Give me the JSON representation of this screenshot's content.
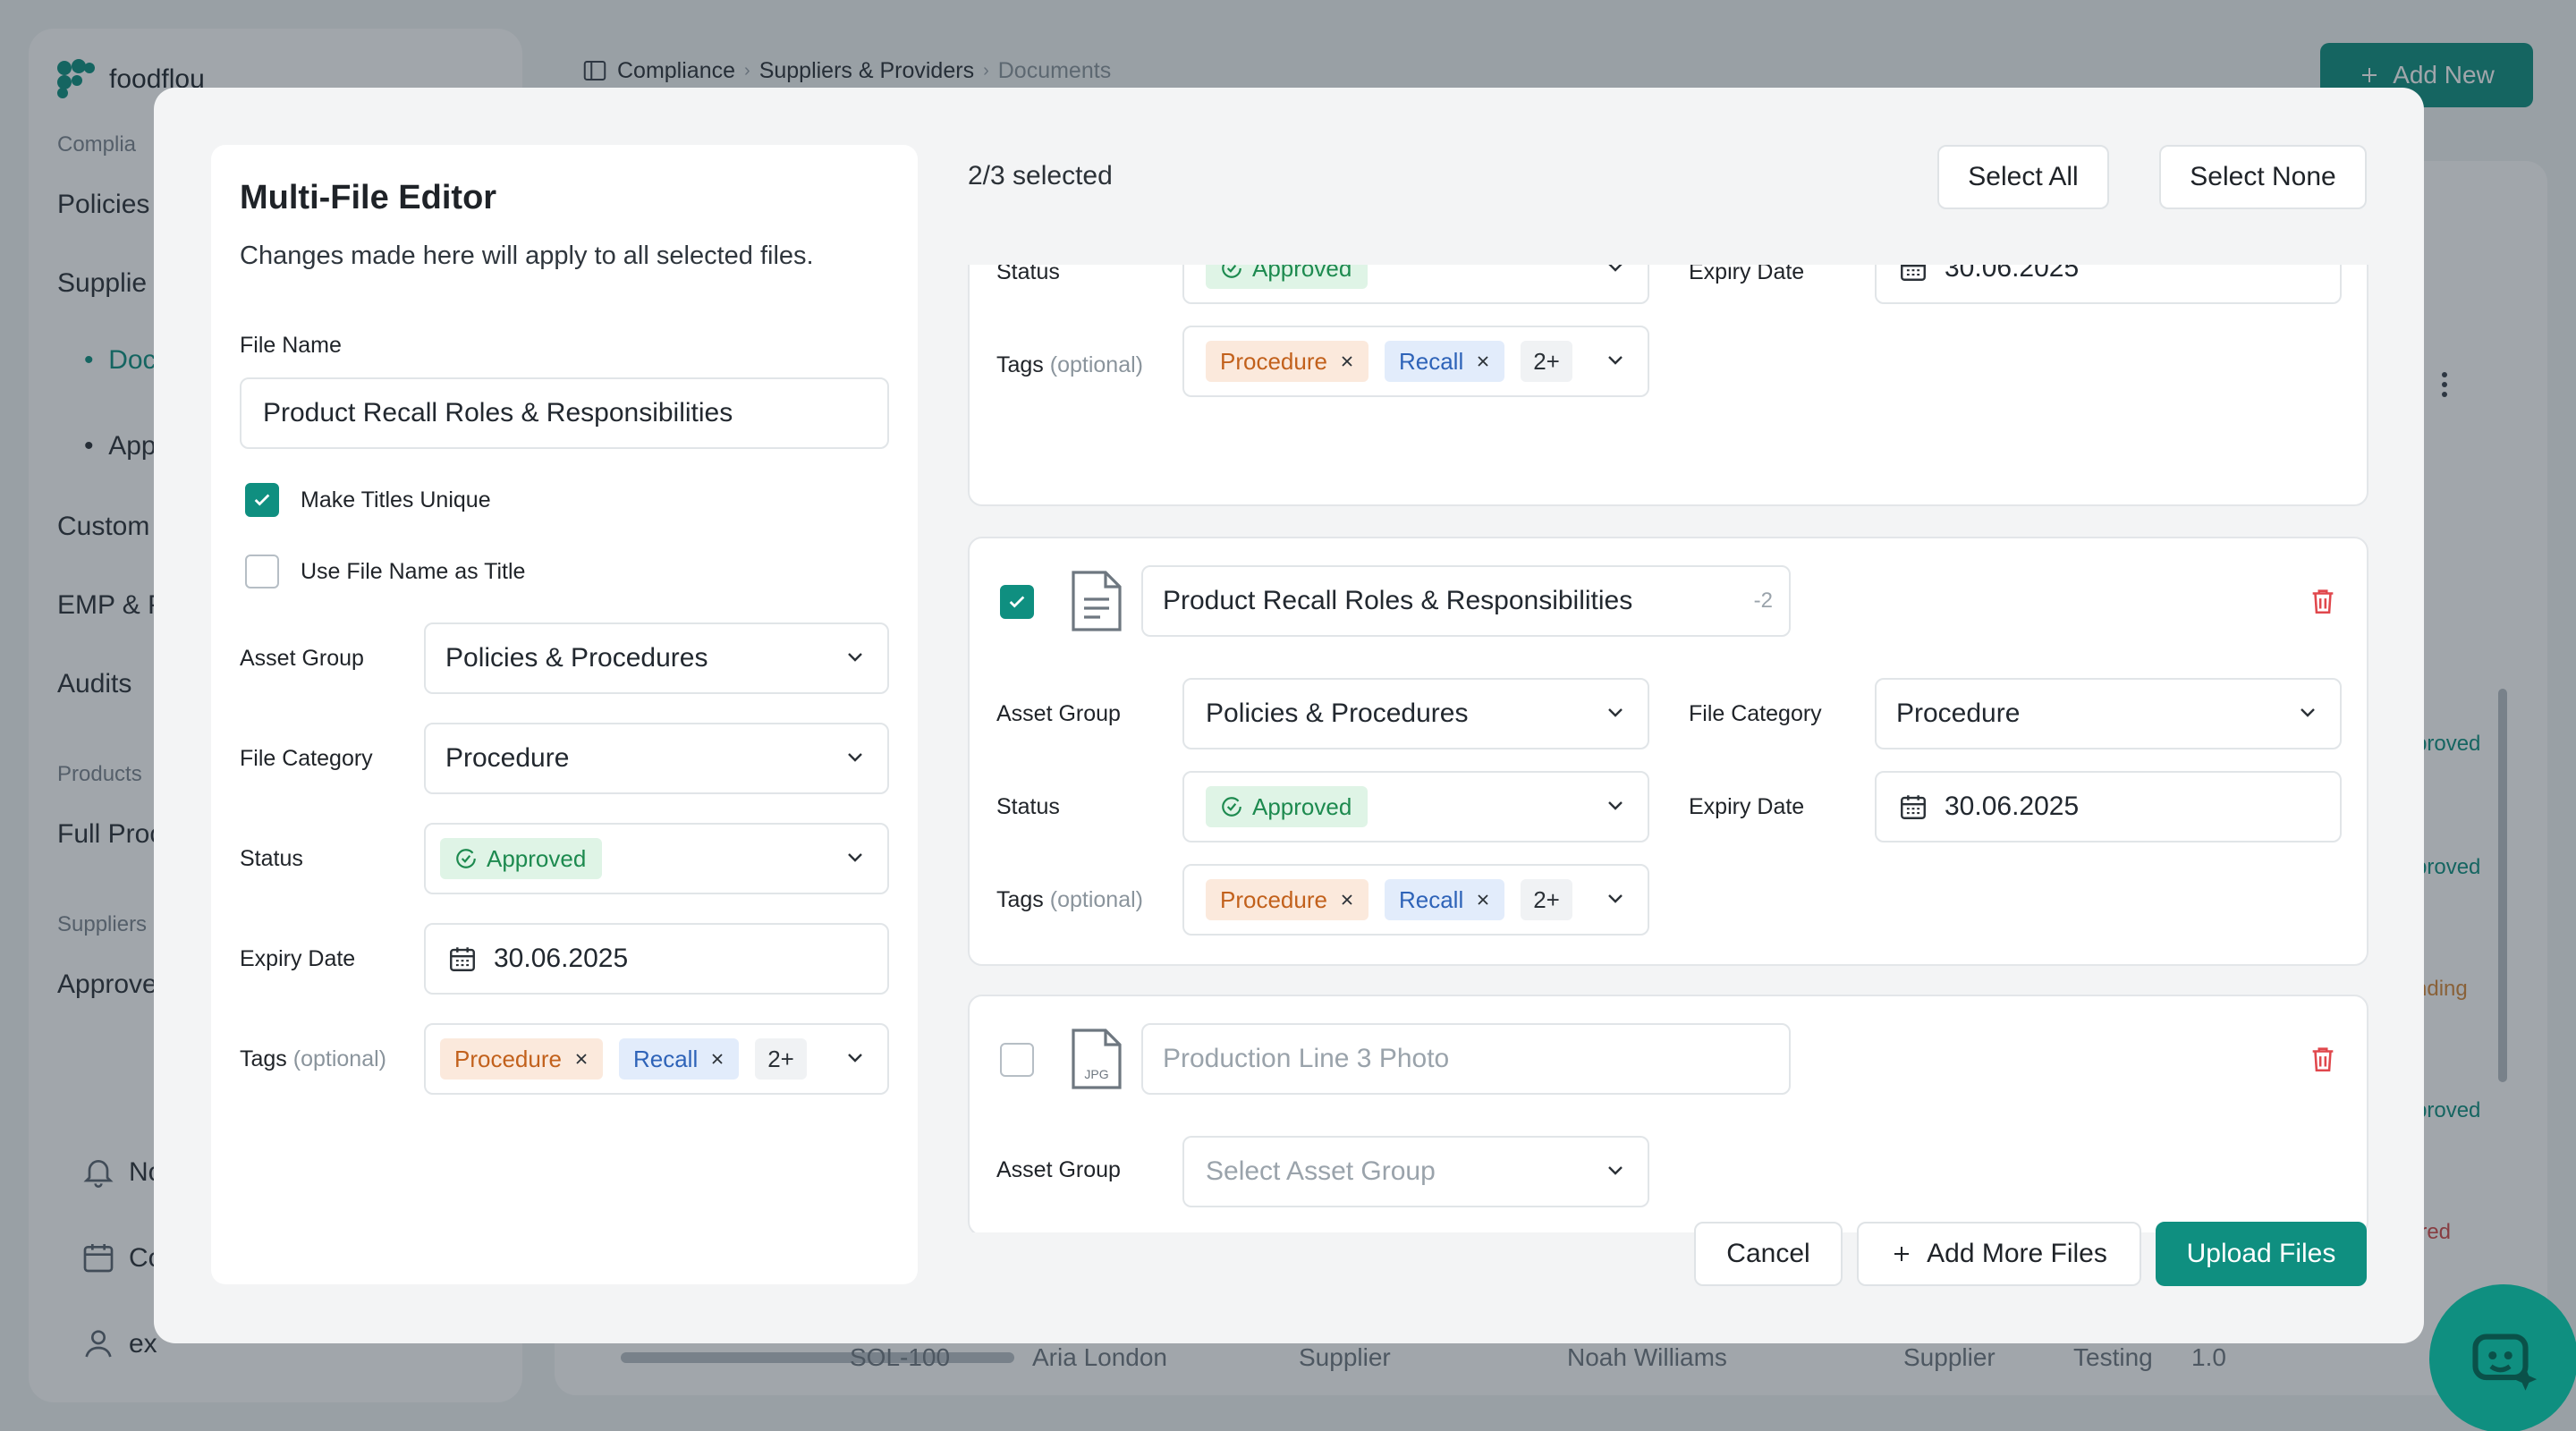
{
  "background": {
    "brand": "foodflou",
    "sidebar": {
      "items": [
        "Complia",
        "Policies",
        "Supplie",
        "Doc",
        "App",
        "Custom",
        "EMP & P",
        "Audits",
        "Products",
        "Full Proc",
        "Suppliers",
        "Approve",
        "No",
        "Co",
        "ex"
      ]
    },
    "breadcrumb": [
      "Compliance",
      "Suppliers & Providers",
      "Documents"
    ],
    "add_new_label": "Add New",
    "status_column": [
      "proved",
      "proved",
      "nding",
      "proved",
      "ired"
    ],
    "footer_row": [
      "SOL-100",
      "Aria London",
      "Supplier",
      "Noah Williams",
      "Supplier",
      "Testing",
      "1.0"
    ]
  },
  "editor": {
    "title": "Multi-File Editor",
    "subtitle": "Changes made here will apply to all selected files.",
    "file_name_label": "File Name",
    "file_name_value": "Product Recall Roles & Responsibilities",
    "make_unique_label": "Make Titles Unique",
    "make_unique_checked": true,
    "use_filename_label": "Use File Name as Title",
    "use_filename_checked": false,
    "asset_group_label": "Asset Group",
    "asset_group_value": "Policies & Procedures",
    "file_category_label": "File Category",
    "file_category_value": "Procedure",
    "status_label": "Status",
    "status_value": "Approved",
    "expiry_label": "Expiry Date",
    "expiry_value": "30.06.2025",
    "tags_label": "Tags",
    "tags_optional": "(optional)",
    "tags": [
      "Procedure",
      "Recall"
    ],
    "tags_more": "2+"
  },
  "selection": {
    "text": "2/3 selected",
    "select_all": "Select All",
    "select_none": "Select None"
  },
  "files": [
    {
      "status_label": "Status",
      "status_value": "Approved",
      "expiry_label": "Expiry Date",
      "expiry_value": "30.06.2025",
      "tags_label": "Tags",
      "tags_optional": "(optional)",
      "tags": [
        "Procedure",
        "Recall"
      ],
      "tags_more": "2+"
    },
    {
      "checked": true,
      "name": "Product Recall Roles & Responsibilities",
      "suffix": "-2",
      "asset_group_label": "Asset Group",
      "asset_group_value": "Policies & Procedures",
      "file_category_label": "File Category",
      "file_category_value": "Procedure",
      "status_label": "Status",
      "status_value": "Approved",
      "expiry_label": "Expiry Date",
      "expiry_value": "30.06.2025",
      "tags_label": "Tags",
      "tags_optional": "(optional)",
      "tags": [
        "Procedure",
        "Recall"
      ],
      "tags_more": "2+"
    },
    {
      "checked": false,
      "file_type": "JPG",
      "name_placeholder": "Production Line 3 Photo",
      "asset_group_label": "Asset Group",
      "asset_group_placeholder": "Select Asset Group"
    }
  ],
  "actions": {
    "cancel": "Cancel",
    "add_more": "Add More Files",
    "upload": "Upload Files"
  },
  "colors": {
    "accent": "#0f8f80",
    "approved_bg": "#dff4e6",
    "approved_text": "#1d8a4f",
    "tag_orange_bg": "#fbe9dc",
    "tag_blue_bg": "#e2ecfb",
    "danger": "#e0474c"
  }
}
